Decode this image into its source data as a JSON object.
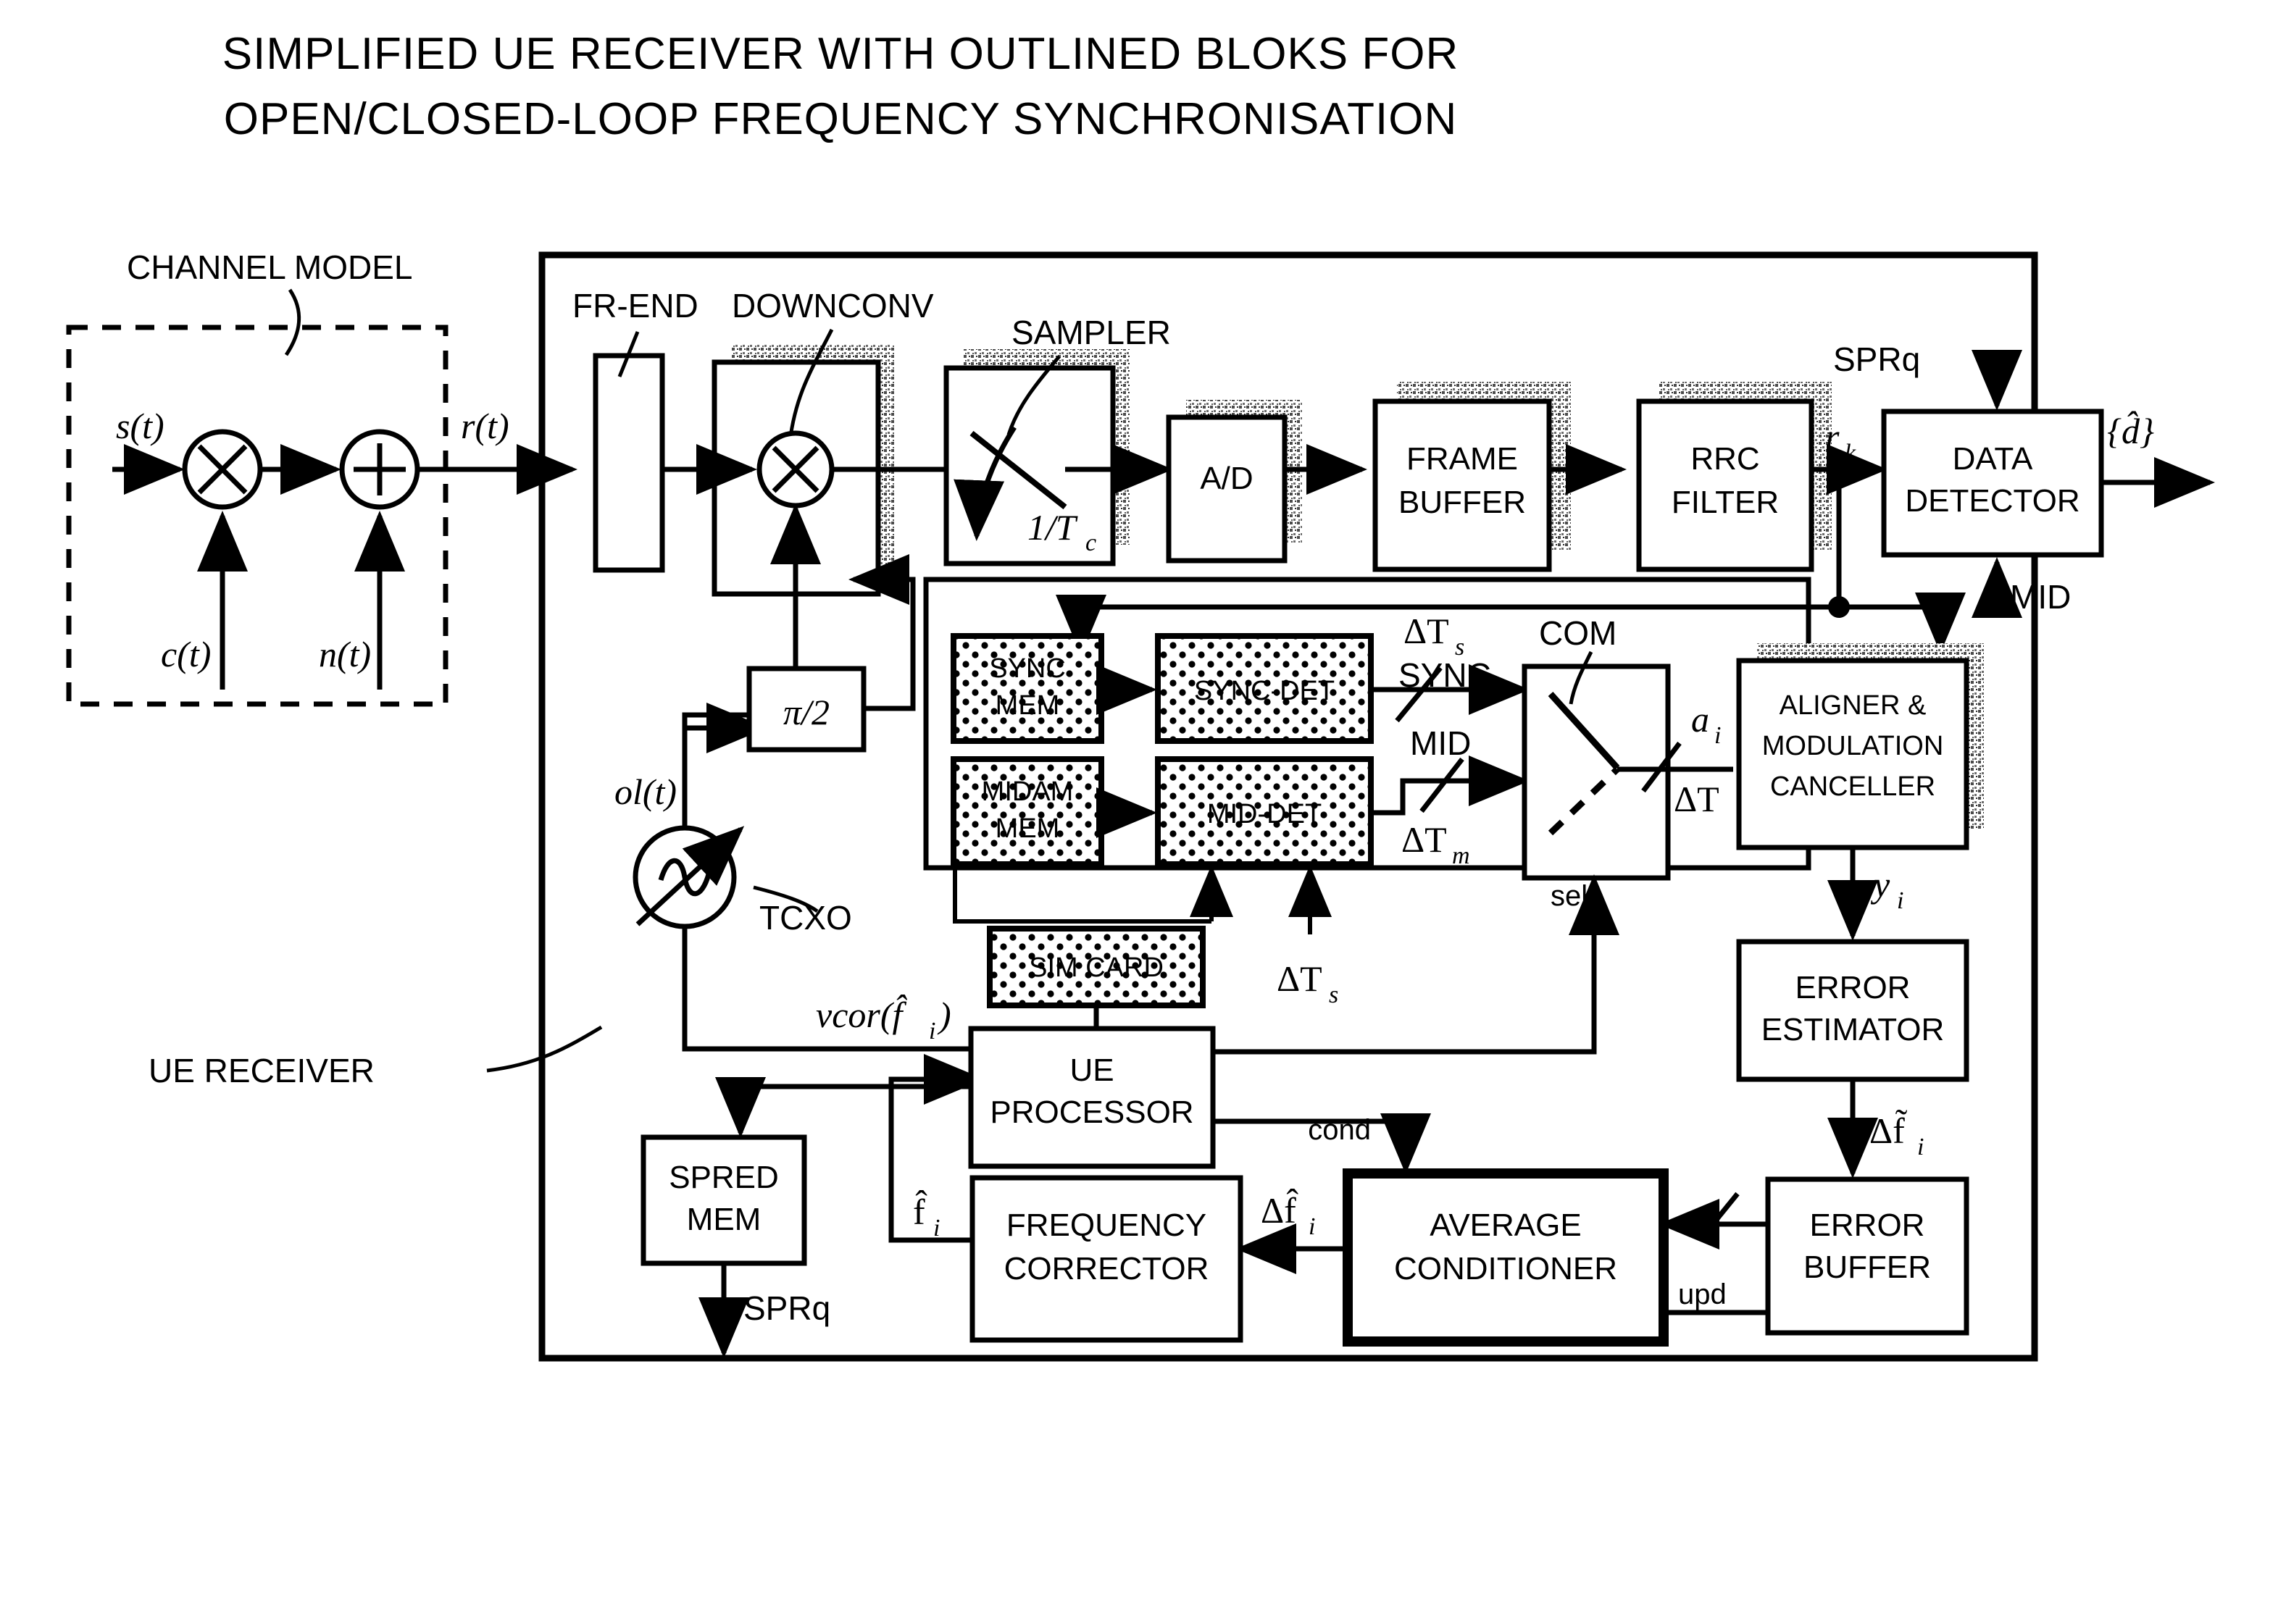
{
  "title": {
    "line1": "SIMPLIFIED UE RECEIVER WITH OUTLINED BLOKS FOR",
    "line2": "OPEN/CLOSED-LOOP FREQUENCY SYNCHRONISATION"
  },
  "annotations": {
    "channel_model": "CHANNEL MODEL",
    "ue_receiver": "UE RECEIVER",
    "fr_end": "FR-END",
    "downconv": "DOWNCONV",
    "sampler": "SAMPLER",
    "com": "COM",
    "tcxo": "TCXO"
  },
  "signals": {
    "s_t": "s(t)",
    "c_t": "c(t)",
    "n_t": "n(t)",
    "r_t": "r(t)",
    "ol_t": "ol(t)",
    "rate": "1/T",
    "rate_sub": "c",
    "r_k": "r",
    "r_k_sub": "k",
    "d_hat": "{d̂}",
    "sprq_top": "SPRq",
    "sprq_bottom": "SPRq",
    "mid_detector_in": "MID",
    "delta_Ts_top": "ΔT",
    "delta_Ts_top_sub": "s",
    "sync_line": "SYNC",
    "mid_line": "MID",
    "delta_Tm": "ΔT",
    "delta_Tm_sub": "m",
    "delta_Ts_bot": "ΔT",
    "delta_Ts_bot_sub": "s",
    "a_i": "a",
    "a_i_sub": "i",
    "delta_T": "ΔT",
    "sel": "sel",
    "y_i": "y",
    "y_i_sub": "i",
    "delta_f_tilde": "Δf̃",
    "delta_f_tilde_sub": "i",
    "delta_f_hat": "Δf̂",
    "delta_f_hat_sub": "i",
    "f_hat": "f̂",
    "f_hat_sub": "i",
    "vcor": "vcor(f̂",
    "vcor_sub": "i",
    "vcor_close": ")",
    "cond": "cond",
    "upd": "upd",
    "pi_over_2": "π/2"
  },
  "blocks": {
    "fr_end": {
      "label": ""
    },
    "ad": {
      "label": "A/D"
    },
    "frame_buffer": {
      "line1": "FRAME",
      "line2": "BUFFER"
    },
    "rrc_filter": {
      "line1": "RRC",
      "line2": "FILTER"
    },
    "data_detector": {
      "line1": "DATA",
      "line2": "DETECTOR"
    },
    "sync_mem": {
      "line1": "SYNC",
      "line2": "MEM"
    },
    "sync_det": {
      "line1": "SYNC-DET"
    },
    "midam_mem": {
      "line1": "MIDAM",
      "line2": "MEM"
    },
    "mid_det": {
      "line1": "MID-DET"
    },
    "sim_card": {
      "line1": "SIM CARD"
    },
    "aligner": {
      "line1": "ALIGNER &",
      "line2": "MODULATION",
      "line3": "CANCELLER"
    },
    "error_estimator": {
      "line1": "ERROR",
      "line2": "ESTIMATOR"
    },
    "error_buffer": {
      "line1": "ERROR",
      "line2": "BUFFER"
    },
    "average_conditioner": {
      "line1": "AVERAGE",
      "line2": "CONDITIONER"
    },
    "frequency_corrector": {
      "line1": "FREQUENCY",
      "line2": "CORRECTOR"
    },
    "ue_processor": {
      "line1": "UE",
      "line2": "PROCESSOR"
    },
    "spred_mem": {
      "line1": "SPRED",
      "line2": "MEM"
    }
  },
  "colors": {
    "ink": "#000000",
    "paper": "#ffffff",
    "shadow": "#8a8a8a"
  }
}
